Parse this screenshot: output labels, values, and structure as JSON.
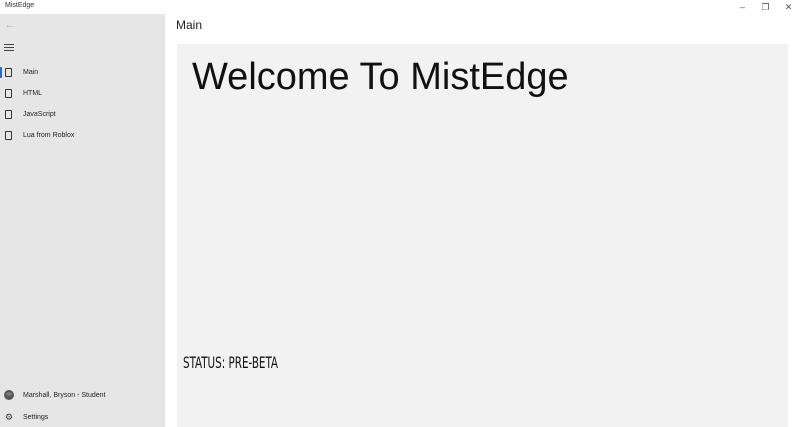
{
  "window": {
    "title": "MistEdge",
    "controls": {
      "minimize": "–",
      "restore": "❐",
      "close": "✕"
    }
  },
  "sidebar": {
    "back_icon": "←",
    "menu_icon": "hamburger-icon",
    "items": [
      {
        "label": "Main",
        "icon": "page-icon",
        "selected": true
      },
      {
        "label": "HTML",
        "icon": "page-icon",
        "selected": false
      },
      {
        "label": "JavaScript",
        "icon": "page-icon",
        "selected": false
      },
      {
        "label": "Lua from Roblox",
        "icon": "page-icon",
        "selected": false
      }
    ],
    "account": {
      "label": "Marshall, Bryson - Student",
      "icon": "avatar"
    },
    "settings": {
      "label": "Settings",
      "icon": "gear-icon"
    }
  },
  "main": {
    "header": "Main",
    "welcome": "Welcome To MistEdge",
    "status": "STATUS: PRE-BETA"
  },
  "colors": {
    "sidebar_bg": "#e6e6e6",
    "panel_bg": "#f2f2f2",
    "accent": "#1e6fd9"
  }
}
